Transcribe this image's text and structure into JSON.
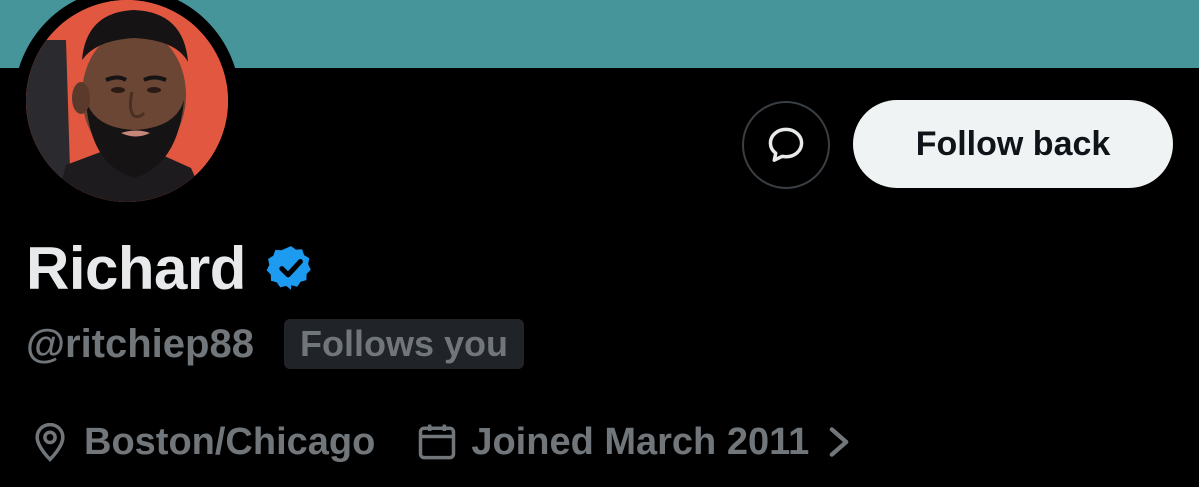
{
  "profile": {
    "display_name": "Richard",
    "handle": "@ritchiep88",
    "follows_you_badge": "Follows you",
    "location": "Boston/Chicago",
    "joined": "Joined March 2011",
    "verified_icon": "verified-badge-icon",
    "avatar_background": "#e2573f"
  },
  "actions": {
    "message_icon": "message-bubble-icon",
    "follow_back_label": "Follow back"
  },
  "colors": {
    "banner": "#45959a",
    "verified": "#1d9bf0",
    "muted_text": "#71767b",
    "primary_text": "#e7e9ea",
    "follow_button_bg": "#eff3f4"
  },
  "icons": {
    "location": "location-pin-icon",
    "joined": "calendar-icon",
    "joined_more": "chevron-right-icon"
  }
}
